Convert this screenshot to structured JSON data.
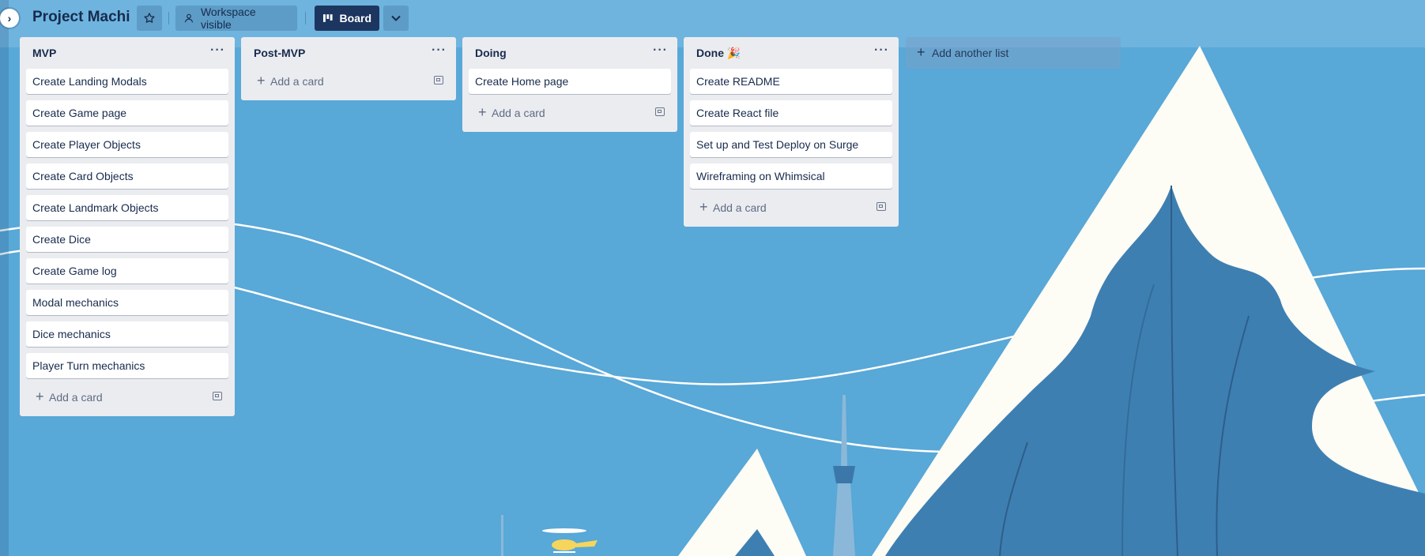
{
  "board": {
    "title": "Project Machi",
    "visibility_label": "Workspace visible",
    "view_label": "Board"
  },
  "lists": [
    {
      "title": "MVP",
      "menu": "···",
      "cards": [
        "Create Landing Modals",
        "Create Game page",
        "Create Player Objects",
        "Create Card Objects",
        "Create Landmark Objects",
        "Create Dice",
        "Create Game log",
        "Modal mechanics",
        "Dice mechanics",
        "Player Turn mechanics"
      ],
      "add_card": "Add a card"
    },
    {
      "title": "Post-MVP",
      "menu": "···",
      "cards": [],
      "add_card": "Add a card"
    },
    {
      "title": "Doing",
      "menu": "···",
      "cards": [
        "Create Home page"
      ],
      "add_card": "Add a card"
    },
    {
      "title": "Done 🎉",
      "menu": "···",
      "cards": [
        "Create README",
        "Create React file",
        "Set up and Test Deploy on Surge",
        "Wireframing on Whimsical"
      ],
      "add_card": "Add a card"
    }
  ],
  "add_list": "Add another list",
  "icons": {
    "sidebar_toggle": "chevron-right-icon",
    "star": "star-icon",
    "visibility": "workspace-visible-icon",
    "board_view": "board-view-icon",
    "view_switcher": "chevron-down-icon",
    "add": "plus-icon",
    "template": "card-template-icon"
  },
  "colors": {
    "background": "#58a8d8",
    "list": "#ebecf0",
    "board_button": "#1d3660"
  }
}
